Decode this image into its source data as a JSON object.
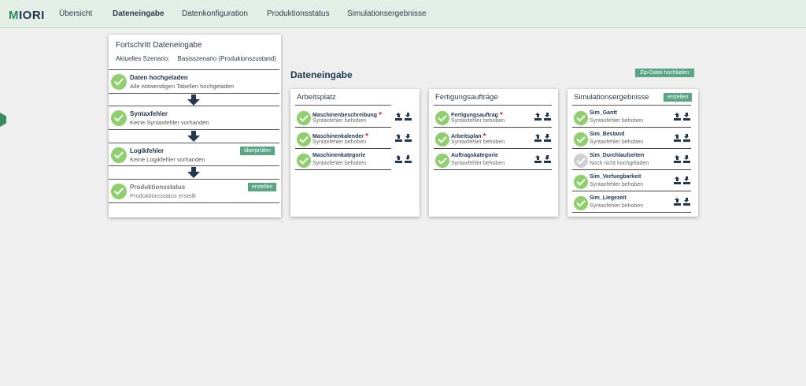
{
  "nav": {
    "logo": "MIORI",
    "items": [
      "Übersicht",
      "Dateneingabe",
      "Datenkonfiguration",
      "Produktionsstatus",
      "Simulationsergebnisse"
    ],
    "active": "Dateneingabe"
  },
  "progress": {
    "title": "Fortschritt Dateneingabe",
    "scenario_label": "Aktuelles Szenario:",
    "scenario_value": "Basisszenario (Produkionszustand)",
    "steps": [
      {
        "title": "Daten hochgeladen",
        "sub": "Alle notwendigen Tabellen hochgeladen"
      },
      {
        "title": "Syntaxfehler",
        "sub": "Keine Syntaxfehler vorhanden"
      },
      {
        "title": "Logikfehler",
        "sub": "Keine Logikfehler vorhanden",
        "button": "überprüfen"
      },
      {
        "title": "Produktionsstatus",
        "sub": "Produktionsstatus erstellt",
        "button": "erstellen"
      }
    ]
  },
  "main": {
    "title": "Dateneingabe",
    "zip_button": "Zip-Datei hochladen"
  },
  "panels": {
    "arbeitsplatz": {
      "title": "Arbeitsplatz",
      "rows": [
        {
          "title": "Maschinenbeschreibung",
          "sub": "Syntaxfehler behoben",
          "required": "*"
        },
        {
          "title": "Maschinenkalender",
          "sub": "Syntaxfehler behoben",
          "required": "*"
        },
        {
          "title": "Maschinenkategorie",
          "sub": "Syntaxfehler behoben"
        }
      ]
    },
    "fertigung": {
      "title": "Fertigungsaufträge",
      "rows": [
        {
          "title": "Fertigungsauftrag",
          "sub": "Syntaxfehler behoben",
          "required": "*"
        },
        {
          "title": "Arbeitsplan",
          "sub": "Syntaxfehler behoben",
          "required": "*"
        },
        {
          "title": "Auftragskategorie",
          "sub": "Syntaxfehler behoben"
        }
      ]
    },
    "simulation": {
      "title": "Simulationsergebnisse",
      "button": "erstellen",
      "rows": [
        {
          "title": "Sim_Gantt",
          "sub": "Syntaxfehler behoben"
        },
        {
          "title": "Sim_Bestand",
          "sub": "Syntaxfehler behoben"
        },
        {
          "title": "Sim_Durchlaufzeiten",
          "sub": "Noch nicht hochgeladen"
        },
        {
          "title": "Sim_Verfuegbarkeit",
          "sub": "Syntaxfehler behoben"
        },
        {
          "title": "Sim_Liegezeit",
          "sub": "Syntaxfehler behoben"
        }
      ]
    }
  },
  "colors": {
    "accent": "#5aa584",
    "check_ok": "#8fcf6e",
    "check_pending": "#cfcfcf",
    "required": "#e0202a"
  },
  "icons": {
    "upload": "upload-icon",
    "download": "download-icon",
    "status": "check-circle-icon"
  }
}
